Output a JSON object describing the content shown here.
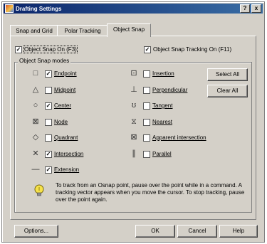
{
  "window": {
    "title": "Drafting Settings",
    "help_glyph": "?",
    "close_glyph": "x"
  },
  "tabs": [
    {
      "label": "Snap and Grid"
    },
    {
      "label": "Polar Tracking"
    },
    {
      "label": "Object Snap",
      "active": true
    }
  ],
  "top_options": {
    "osnap_on": {
      "label": "Object Snap On (F3)",
      "checked": true
    },
    "osnap_tracking": {
      "label": "Object Snap Tracking On (F11)",
      "checked": true
    }
  },
  "modes_group_title": "Object Snap modes",
  "modes_left": [
    {
      "label": "Endpoint",
      "checked": true,
      "icon": "endpoint-icon",
      "glyph": "□"
    },
    {
      "label": "Midpoint",
      "checked": false,
      "icon": "midpoint-icon",
      "glyph": "△"
    },
    {
      "label": "Center",
      "checked": true,
      "icon": "center-icon",
      "glyph": "○"
    },
    {
      "label": "Node",
      "checked": false,
      "icon": "node-icon",
      "glyph": "⊠"
    },
    {
      "label": "Quadrant",
      "checked": false,
      "icon": "quadrant-icon",
      "glyph": "◇"
    },
    {
      "label": "Intersection",
      "checked": true,
      "icon": "intersection-icon",
      "glyph": "✕"
    },
    {
      "label": "Extension",
      "checked": true,
      "icon": "extension-icon",
      "glyph": "—"
    }
  ],
  "modes_right": [
    {
      "label": "Insertion",
      "checked": false,
      "icon": "insertion-icon",
      "glyph": "⊡"
    },
    {
      "label": "Perpendicular",
      "checked": false,
      "icon": "perpendicular-icon",
      "glyph": "⊥"
    },
    {
      "label": "Tangent",
      "checked": false,
      "icon": "tangent-icon",
      "glyph": "ʊ"
    },
    {
      "label": "Nearest",
      "checked": false,
      "icon": "nearest-icon",
      "glyph": "⧖"
    },
    {
      "label": "Apparent intersection",
      "checked": false,
      "icon": "apparent-intersection-icon",
      "glyph": "⊠"
    },
    {
      "label": "Parallel",
      "checked": false,
      "icon": "parallel-icon",
      "glyph": "∥"
    }
  ],
  "buttons": {
    "select_all": "Select All",
    "clear_all": "Clear All",
    "options": "Options...",
    "ok": "OK",
    "cancel": "Cancel",
    "help": "Help"
  },
  "info_text": "To track from an Osnap point, pause over the point while in a command.  A tracking vector appears when you move the cursor. To stop tracking, pause over the point again."
}
